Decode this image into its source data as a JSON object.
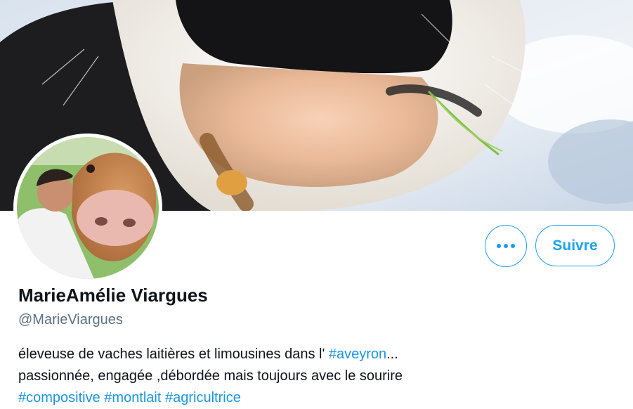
{
  "banner": {
    "alt": "cow-muzzle-closeup"
  },
  "profile": {
    "display_name": "MarieAmélie Viargues",
    "handle": "@MarieViargues"
  },
  "actions": {
    "more_icon": "ellipsis-icon",
    "follow_label": "Suivre"
  },
  "bio": {
    "line1_text": "éleveuse de vaches laitières et limousines dans l' ",
    "line1_tag": "#aveyron",
    "line1_suffix": "...",
    "line2_text": "passionnée, engagée ,débordée mais toujours avec le sourire",
    "line3_tag1": "#compositive",
    "line3_tag2": "#montlait",
    "line3_tag3": "#agricultrice"
  },
  "colors": {
    "accent": "#1da1f2",
    "name_text": "#0f1419",
    "secondary_text": "#5b7083"
  }
}
